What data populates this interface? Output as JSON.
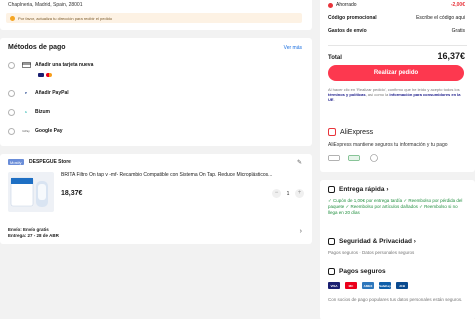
{
  "address": {
    "text": "Chaplneria, Madrid, Spain, 28001",
    "warning": "Por favor, actualiza tu dirección para recibir el pedido"
  },
  "payment": {
    "title": "Métodos de pago",
    "more_link": "Ver más",
    "methods": [
      {
        "label": "Añadir una tarjeta nueva",
        "icon": "credit-card-icon"
      },
      {
        "label": "Añadir PayPal",
        "icon": "paypal-icon"
      },
      {
        "label": "Bizum",
        "icon": "bizum-icon"
      },
      {
        "label": "Google Pay",
        "icon": "google-pay-icon"
      }
    ],
    "card_icons": [
      "visa-icon",
      "mastercard-icon"
    ]
  },
  "store": {
    "badge": "Mostly",
    "name": "DESPEGUE Store",
    "product_title": "BRITA Filtro On tap v -mf- Recambio Compatible con Sistema On Tap. Reduce Microplásticos...",
    "price": "18,37€",
    "quantity": "1",
    "shipping": "Envío: Envío gratis",
    "delivery": "Entrega: 27 - 28 de ABR"
  },
  "summary": {
    "saved_label": "Ahorrado",
    "saved_value": "-2,00€",
    "promo_label": "Código promocional",
    "promo_value": "Escribe el código aqui",
    "shipping_label": "Gastos de envío",
    "shipping_value": "Gratis",
    "total_label": "Total",
    "total_value": "16,37€",
    "place_order": "Realizar pedido",
    "terms_prefix": "Al hacer clic en 'Realizar pedido', confirmo que he leído y acepto todos los ",
    "terms_link": "términos y políticas",
    "terms_mid": ", así como la ",
    "terms_link2": "información para consumidores en la UE",
    "terms_suffix": "."
  },
  "trust": {
    "title": "AliExpress",
    "desc": "AliExpress mantiene seguros tu información y tu pago",
    "badges": [
      "pci-badge",
      "secure-badge",
      "privacy-badge"
    ]
  },
  "fast": {
    "title": "Entrega rápida",
    "desc": "✓ Cupón de 1,00€ por entrega tardía  ✓ Reembolso por pérdida del paquete  ✓ Reembolso por artículos dañados  ✓ Reembolso si no llega en 20 días",
    "security_title": "Seguridad & Privacidad",
    "security_desc": "Pagos seguros · Datos personales seguros",
    "safe_title": "Pagos seguros",
    "safe_logos": [
      "VISA",
      "MC",
      "AMEX",
      "SafeKey",
      "JCB"
    ],
    "safe_desc": "Con socios de pago populares tus datos personales están seguros."
  },
  "colors": {
    "accent": "#fd384f",
    "link": "#1a6fe0",
    "green": "#1f8e3d"
  }
}
